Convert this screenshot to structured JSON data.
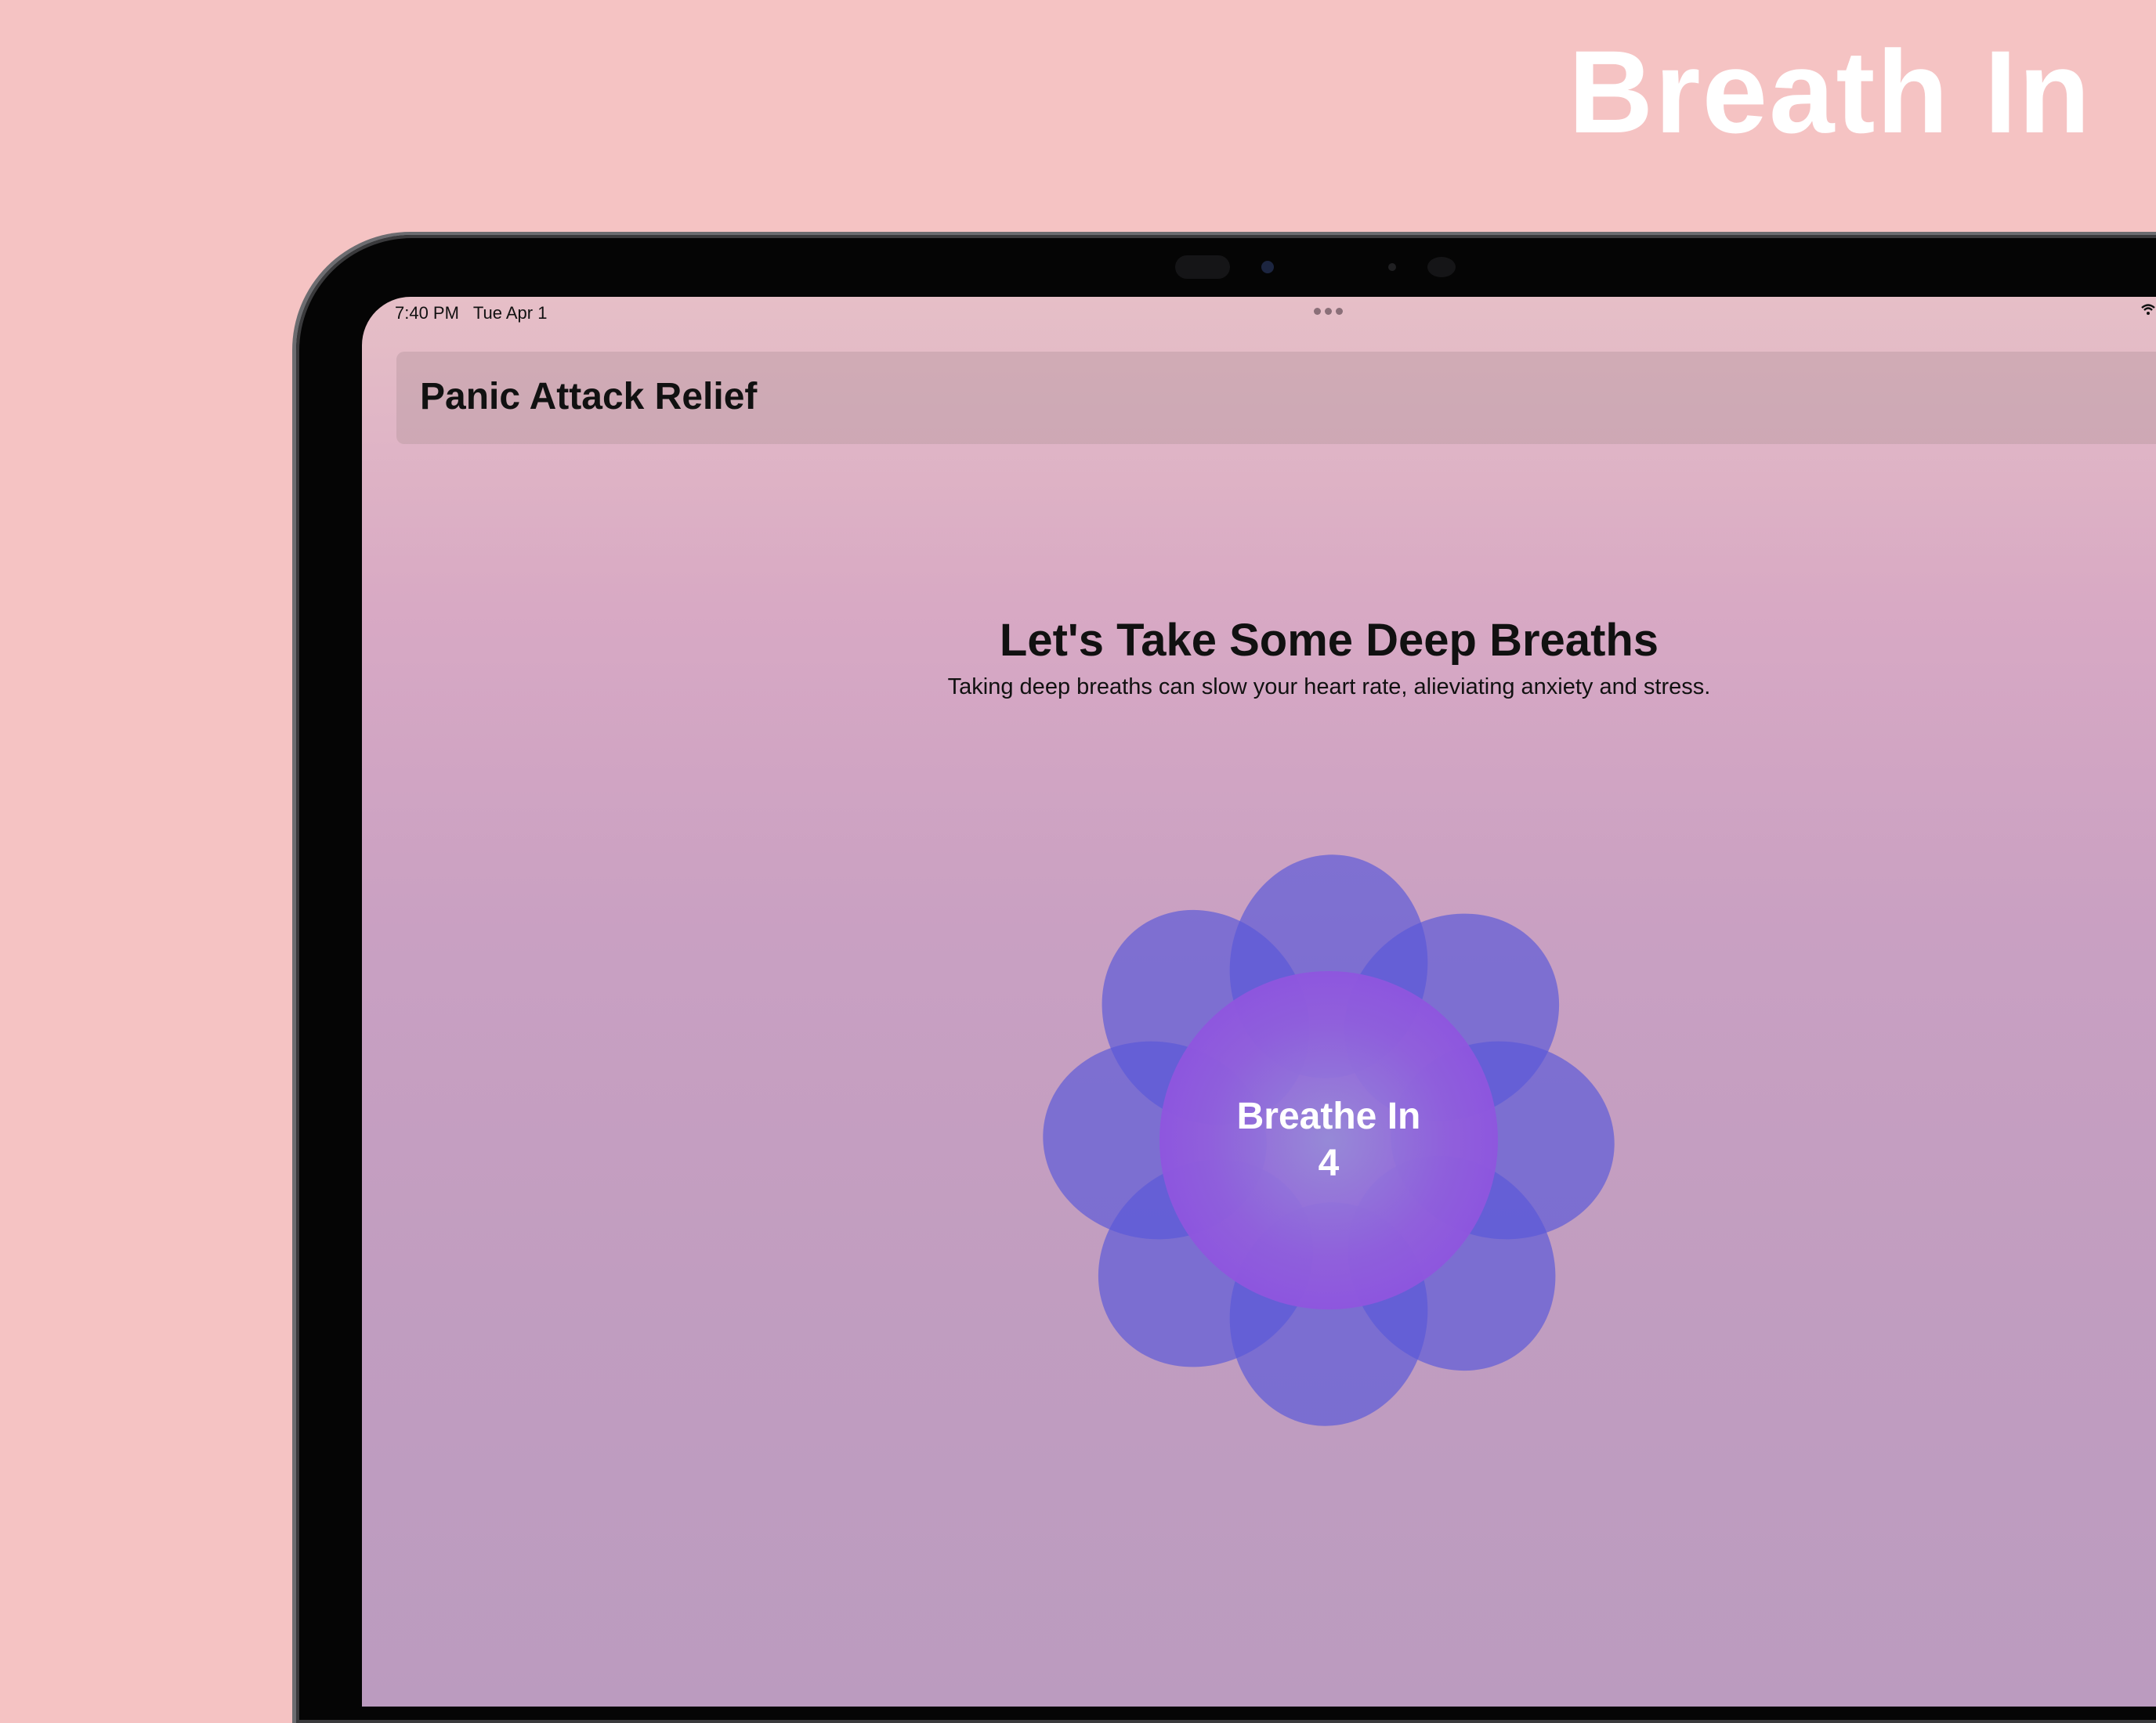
{
  "promo": {
    "headline": "Breath In"
  },
  "status_bar": {
    "time": "7:40 PM",
    "date": "Tue Apr 1",
    "time_date": "7:40 PM   Tue Apr 1"
  },
  "nav": {
    "title": "Panic Attack Relief"
  },
  "content": {
    "heading": "Let's Take Some Deep Breaths",
    "subheading": "Taking deep breaths can slow your heart rate, alieviating anxiety and stress."
  },
  "breathing": {
    "phase": "Breathe In",
    "count": "4",
    "petal_color": "#5a58d8",
    "center_color": "#9a5ce0"
  },
  "colors": {
    "background": "#f5c3c3",
    "screen_top": "#e6bfc7",
    "screen_bottom": "#bb9bbf"
  }
}
